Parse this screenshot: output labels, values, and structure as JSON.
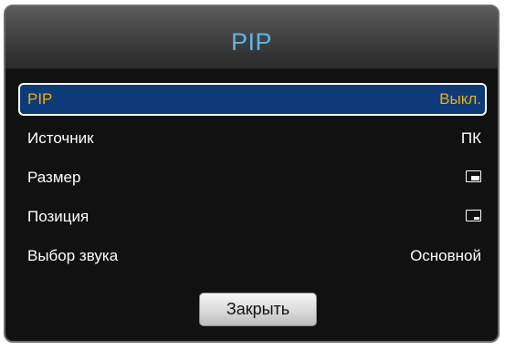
{
  "dialog": {
    "title": "PIP",
    "menu_items": [
      {
        "label": "PIP",
        "value": "Выкл."
      },
      {
        "label": "Источник",
        "value": "ПК"
      },
      {
        "label": "Размер",
        "value_icon": "pip-size-icon"
      },
      {
        "label": "Позиция",
        "value_icon": "pip-position-icon"
      },
      {
        "label": "Выбор звука",
        "value": "Основной"
      }
    ],
    "close_label": "Закрыть"
  },
  "colors": {
    "title": "#5fb4e6",
    "selected_text": "#f0b000",
    "selected_background": "#0d3a78",
    "panel_background": "#111111"
  }
}
